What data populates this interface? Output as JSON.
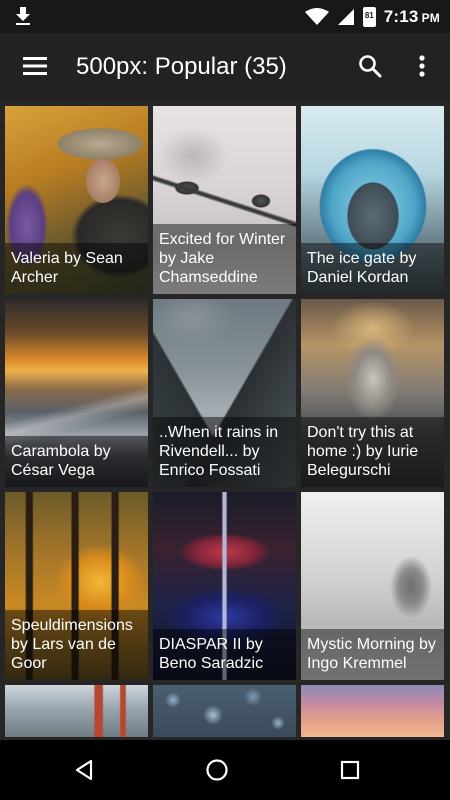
{
  "status_bar": {
    "time": "7:13",
    "ampm": "PM",
    "battery_level": "81",
    "icons": [
      "download-icon",
      "wifi-icon",
      "signal-icon",
      "battery-icon"
    ]
  },
  "app_bar": {
    "title": "500px: Popular (35)",
    "icons": [
      "menu-icon",
      "search-icon",
      "more-vert-icon"
    ],
    "background": "#222222"
  },
  "grid": {
    "photos": [
      {
        "caption": "Valeria by Sean Archer"
      },
      {
        "caption": "Excited for Winter by Jake Chamseddine"
      },
      {
        "caption": "The ice gate by Daniel Kordan"
      },
      {
        "caption": "Carambola by César Vega"
      },
      {
        "caption": "..When it rains in Rivendell... by Enrico Fossati"
      },
      {
        "caption": "Don't try this at home :) by Iurie Belegurschi"
      },
      {
        "caption": "Speuldimensions by Lars van de Goor"
      },
      {
        "caption": "DIASPAR II by Beno Saradzic"
      },
      {
        "caption": "Mystic Morning by Ingo Kremmel"
      },
      {
        "caption": ""
      },
      {
        "caption": ""
      },
      {
        "caption": ""
      }
    ]
  },
  "nav_bar": {
    "icons": [
      "back-icon",
      "home-icon",
      "recents-icon"
    ]
  }
}
